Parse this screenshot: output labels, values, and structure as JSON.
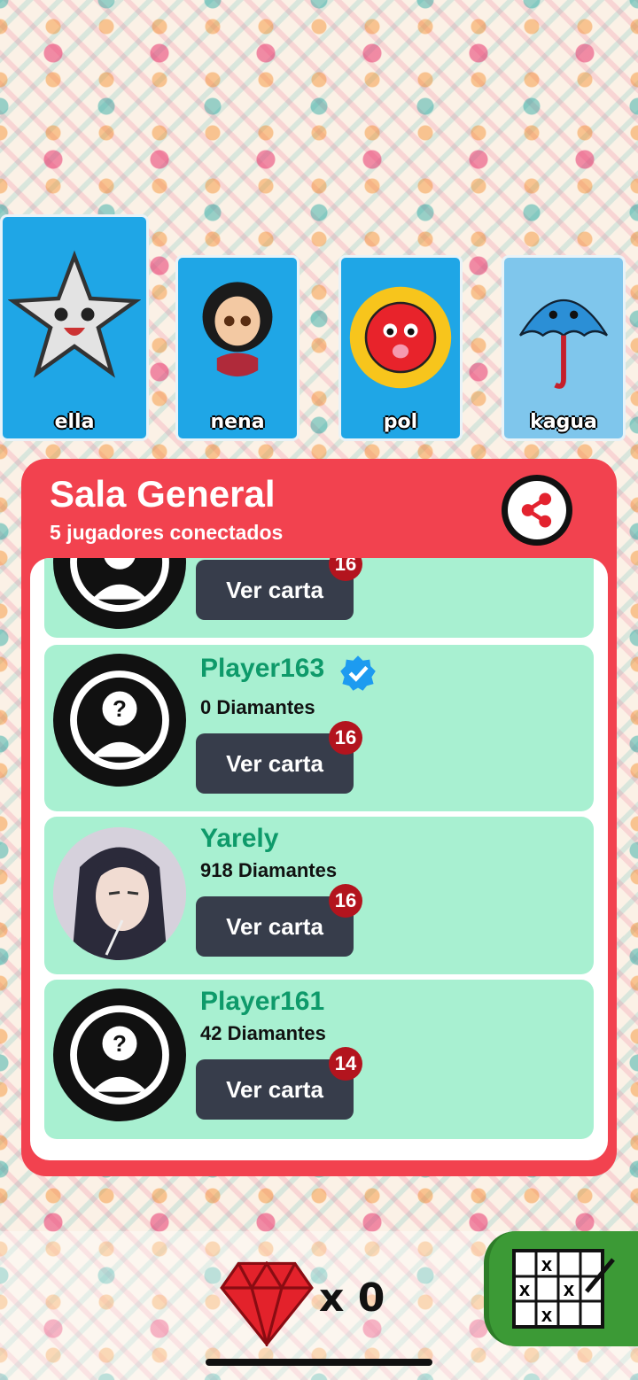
{
  "cards": [
    {
      "name": "ella"
    },
    {
      "name": "nena"
    },
    {
      "name": "pol"
    },
    {
      "name": "kagua"
    }
  ],
  "room": {
    "title": "Sala General",
    "subtitle": "5 jugadores conectados"
  },
  "players": [
    {
      "name": "",
      "diamonds": "",
      "button": "Ver carta",
      "badge": "16"
    },
    {
      "name": "Player163",
      "diamonds": "0 Diamantes",
      "button": "Ver carta",
      "badge": "16"
    },
    {
      "name": "Yarely",
      "diamonds": "918 Diamantes",
      "button": "Ver carta",
      "badge": "16"
    },
    {
      "name": "Player161",
      "diamonds": "42 Diamantes",
      "button": "Ver carta",
      "badge": "14"
    }
  ],
  "footer": {
    "diamond_count": "x 0"
  },
  "colors": {
    "panel": "#f2424f",
    "row": "#a8f0d1",
    "name": "#0e9a6a",
    "button": "#373d4b",
    "badge": "#b3141e"
  }
}
